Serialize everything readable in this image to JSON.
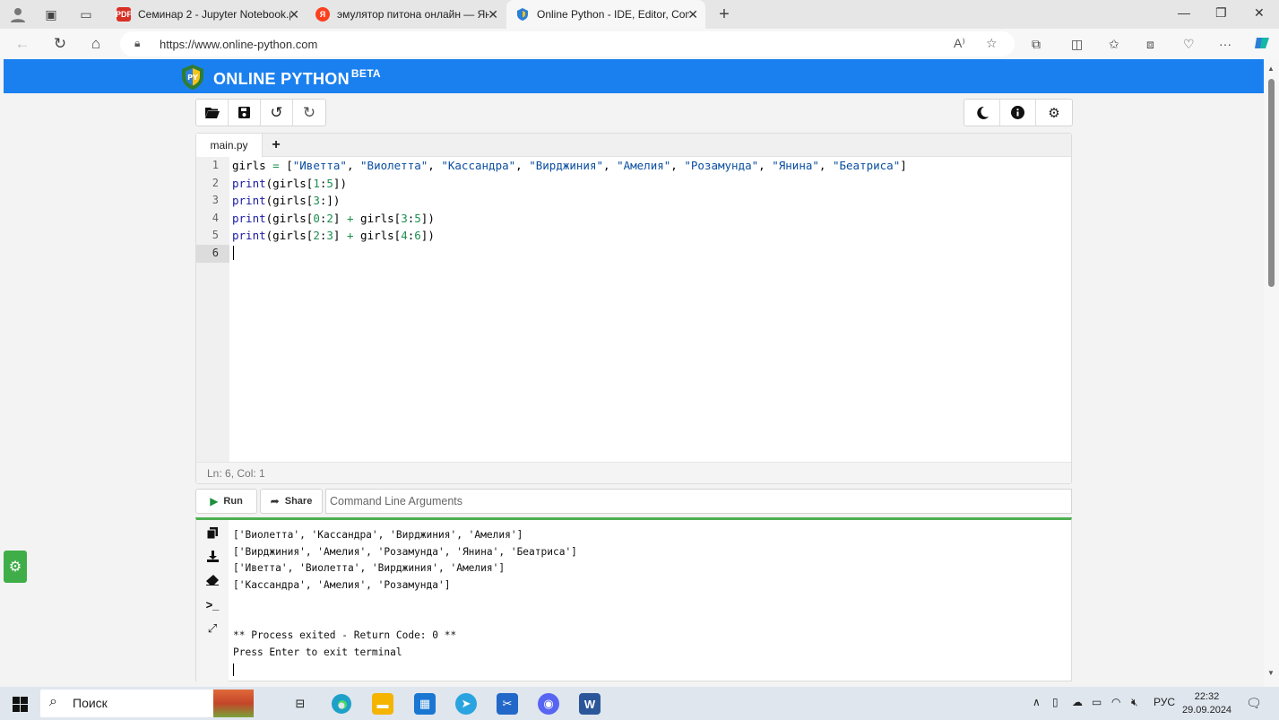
{
  "browser": {
    "tabs": [
      {
        "title": "Семинар 2 - Jupyter Notebook.pdf",
        "favicon": "pdf-icon"
      },
      {
        "title": "эмулятор питона онлайн — Яндекс",
        "favicon": "yandex-icon"
      },
      {
        "title": "Online Python - IDE, Editor, Compiler",
        "favicon": "online-python-icon"
      }
    ],
    "url": "https://www.online-python.com"
  },
  "site": {
    "brand": "ONLINE PYTHON",
    "badge": "BETA"
  },
  "editor": {
    "filename": "main.py",
    "add_tab": "+",
    "line_numbers": [
      "1",
      "2",
      "3",
      "4",
      "5",
      "6"
    ],
    "status": "Ln: 6,  Col: 1"
  },
  "actions": {
    "run": "Run",
    "share": "Share",
    "args_placeholder": "Command Line Arguments"
  },
  "terminal": {
    "lines": [
      "['Виолетта', 'Кассандра', 'Вирджиния', 'Амелия']",
      "['Вирджиния', 'Амелия', 'Розамунда', 'Янина', 'Беатриса']",
      "['Иветта', 'Виолетта', 'Вирджиния', 'Амелия']",
      "['Кассандра', 'Амелия', 'Розамунда']",
      "** Process exited - Return Code: 0 **",
      "Press Enter to exit terminal"
    ]
  },
  "taskbar": {
    "search": "Поиск",
    "lang": "РУС",
    "time": "22:32",
    "date": "29.09.2024"
  },
  "colors": {
    "banner": "#1b80ef",
    "terminal_accent": "#4caf50",
    "fab": "#3fae49"
  }
}
